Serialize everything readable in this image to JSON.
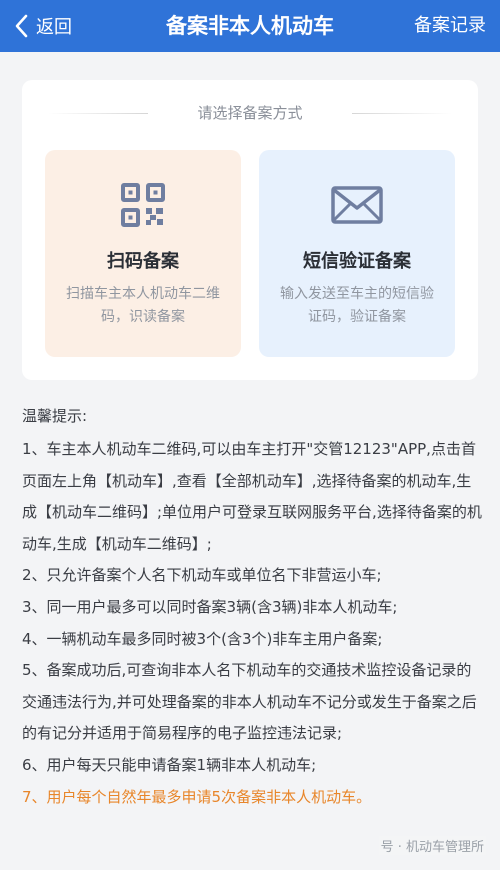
{
  "header": {
    "back_label": "返回",
    "title": "备案非本人机动车",
    "right_label": "备案记录"
  },
  "chooser": {
    "prompt": "请选择备案方式",
    "options": [
      {
        "name": "扫码备案",
        "description": "扫描车主本人机动车二维码，识读备案",
        "icon": "qr-code-icon"
      },
      {
        "name": "短信验证备案",
        "description": "输入发送至车主的短信验证码，验证备案",
        "icon": "envelope-icon"
      }
    ]
  },
  "tips": {
    "heading": "温馨提示:",
    "items": [
      "1、车主本人机动车二维码,可以由车主打开\"交管12123\"APP,点击首页面左上角【机动车】,查看【全部机动车】,选择待备案的机动车,生成【机动车二维码】;单位用户可登录互联网服务平台,选择待备案的机动车,生成【机动车二维码】;",
      "2、只允许备案个人名下机动车或单位名下非营运小车;",
      "3、同一用户最多可以同时备案3辆(含3辆)非本人机动车;",
      "4、一辆机动车最多同时被3个(含3个)非车主用户备案;",
      "5、备案成功后,可查询非本人名下机动车的交通技术监控设备记录的交通违法行为,并可处理备案的非本人机动车不记分或发生于备案之后的有记分并适用于简易程序的电子监控违法记录;",
      "6、用户每天只能申请备案1辆非本人机动车;",
      "7、用户每个自然年最多申请5次备案非本人机动车。"
    ]
  },
  "watermark": "号 · 机动车管理所",
  "colors": {
    "nav_bg": "#2f73d8",
    "scan_card_bg": "#fcefe5",
    "sms_card_bg": "#e7f1fd",
    "highlight_text": "#e8862a"
  }
}
